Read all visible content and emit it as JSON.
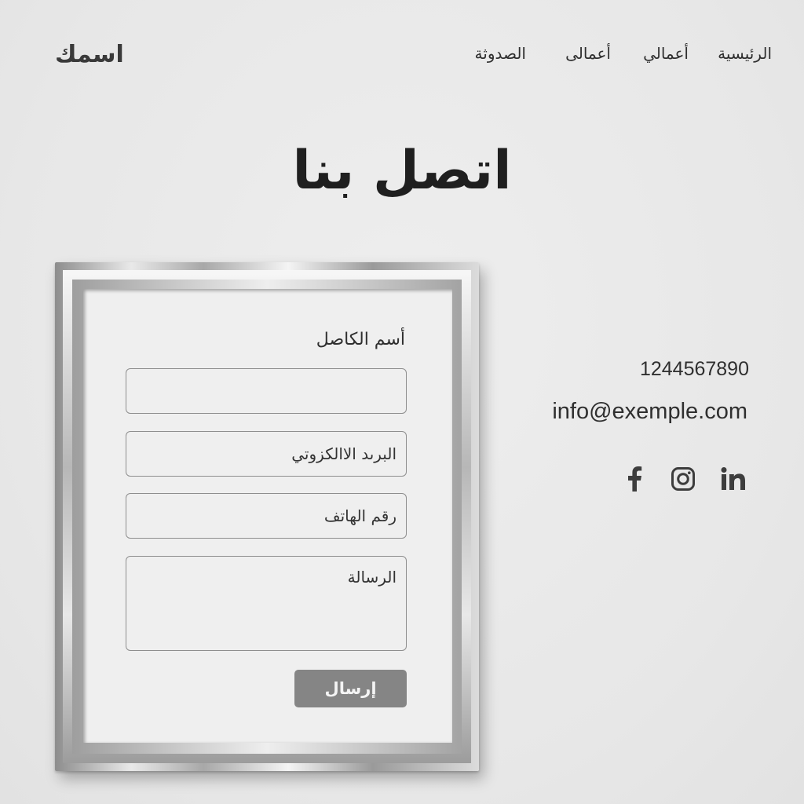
{
  "header": {
    "logo": "اسمك",
    "nav": [
      {
        "label": "الرئيسية"
      },
      {
        "label": "أعمالي"
      },
      {
        "label": "أعمالى"
      },
      {
        "label": "الصدوثة"
      }
    ]
  },
  "main": {
    "title": "اتصل بنا"
  },
  "form": {
    "name_label": "أسم الكاصل",
    "name_value": "",
    "email_placeholder": "البرىد الاالكزوتي",
    "phone_placeholder": "رقم الهاتف",
    "message_placeholder": "الرسالة",
    "submit_label": "إرسال"
  },
  "contact": {
    "phone": "1244567890",
    "email": "info@exemple.com",
    "social": [
      {
        "icon": "facebook-icon"
      },
      {
        "icon": "instagram-icon"
      },
      {
        "icon": "linkedin-icon"
      }
    ]
  },
  "colors": {
    "background": "#ebebeb",
    "text": "#2b2b2b",
    "button": "#858585",
    "frame": "#b5b5b5"
  }
}
